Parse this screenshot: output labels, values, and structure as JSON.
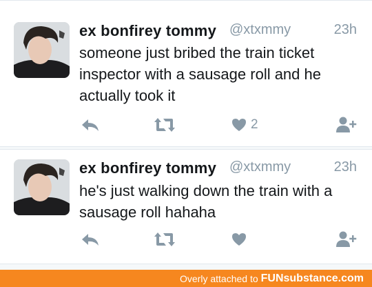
{
  "tweets": [
    {
      "name": "ex bonfirey tommy",
      "handle": "@xtxmmy",
      "time": "23h",
      "text": "someone just bribed the train ticket inspector with a sausage roll and he actually took it",
      "like_count": "2"
    },
    {
      "name": "ex bonfirey tommy",
      "handle": "@xtxmmy",
      "time": "23h",
      "text": "he's just walking down the train with a sausage roll hahaha",
      "like_count": ""
    }
  ],
  "watermark": {
    "text": "Overly attached to",
    "brand": "FUNsubstance.com"
  },
  "colors": {
    "accent": "#8899a6",
    "watermark_bg": "#f6871f"
  },
  "icons": [
    "reply-icon",
    "retweet-icon",
    "heart-icon",
    "follow-icon"
  ]
}
